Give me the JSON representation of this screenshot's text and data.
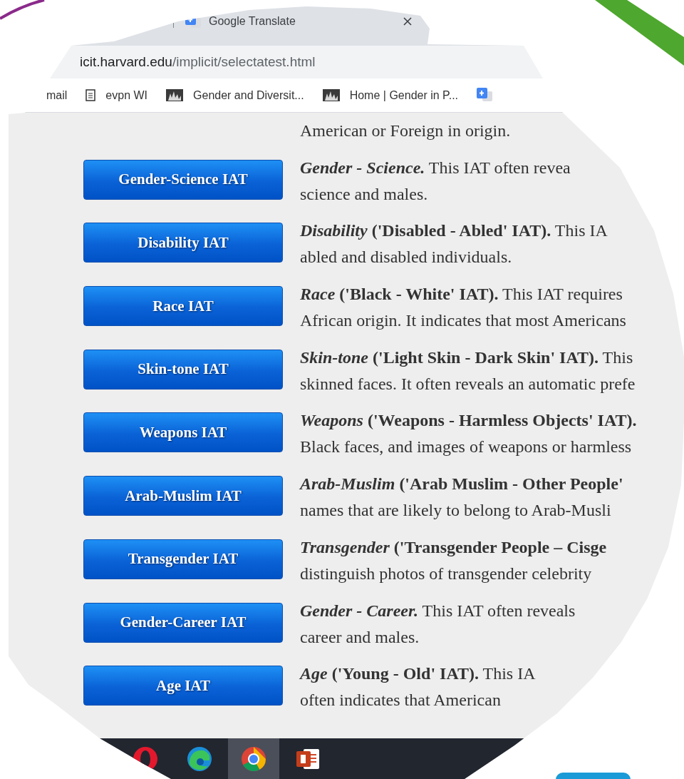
{
  "browser": {
    "tab": {
      "title": "Google Translate"
    },
    "address": {
      "domain": "icit.harvard.edu",
      "path": "/implicit/selectatest.html"
    },
    "bookmarks": [
      {
        "label": "mail",
        "kind": "plain"
      },
      {
        "label": "evpn WI",
        "kind": "page"
      },
      {
        "label": "Gender and Diversit...",
        "kind": "image"
      },
      {
        "label": "Home | Gender in P...",
        "kind": "image"
      },
      {
        "kind": "translate"
      }
    ]
  },
  "page": {
    "intro": "American or Foreign in origin.",
    "tests": [
      {
        "button": "Gender-Science IAT",
        "topic": "Gender - Science.",
        "text": "This IAT often revea",
        "line_2": "science and males."
      },
      {
        "button": "Disability IAT",
        "topic": "Disability",
        "subtitle": "('Disabled - Abled' IAT).",
        "text": "This IA",
        "line_2": "abled and disabled individuals."
      },
      {
        "button": "Race IAT",
        "topic": "Race",
        "subtitle": "('Black - White' IAT).",
        "text": "This IAT requires",
        "line_2": "African origin. It indicates that most Americans"
      },
      {
        "button": "Skin-tone IAT",
        "topic": "Skin-tone",
        "subtitle": "('Light Skin - Dark Skin' IAT).",
        "text": "This",
        "line_2": "skinned faces. It often reveals an automatic prefe"
      },
      {
        "button": "Weapons IAT",
        "topic": "Weapons",
        "subtitle": "('Weapons - Harmless Objects' IAT).",
        "line_2": "Black faces, and images of weapons or harmless"
      },
      {
        "button": "Arab-Muslim IAT",
        "topic": "Arab-Muslim",
        "subtitle": "('Arab Muslim - Other People'",
        "line_2": "names that are likely to belong to Arab-Musli"
      },
      {
        "button": "Transgender IAT",
        "topic": "Transgender",
        "subtitle": "('Transgender People – Cisge",
        "line_2": "distinguish photos of transgender celebrity"
      },
      {
        "button": "Gender-Career IAT",
        "topic": "Gender - Career.",
        "text": "This IAT often reveals",
        "line_2": "career and males."
      },
      {
        "button": "Age IAT",
        "topic": "Age",
        "subtitle": "('Young - Old' IAT).",
        "text": "This IA",
        "line_2": "often indicates that American"
      }
    ]
  },
  "taskbar": {
    "apps": [
      {
        "kind": "dot",
        "selected": false
      },
      {
        "kind": "swirl",
        "selected": false
      },
      {
        "kind": "ring",
        "selected": true
      },
      {
        "kind": "slides",
        "selected": false
      }
    ]
  }
}
